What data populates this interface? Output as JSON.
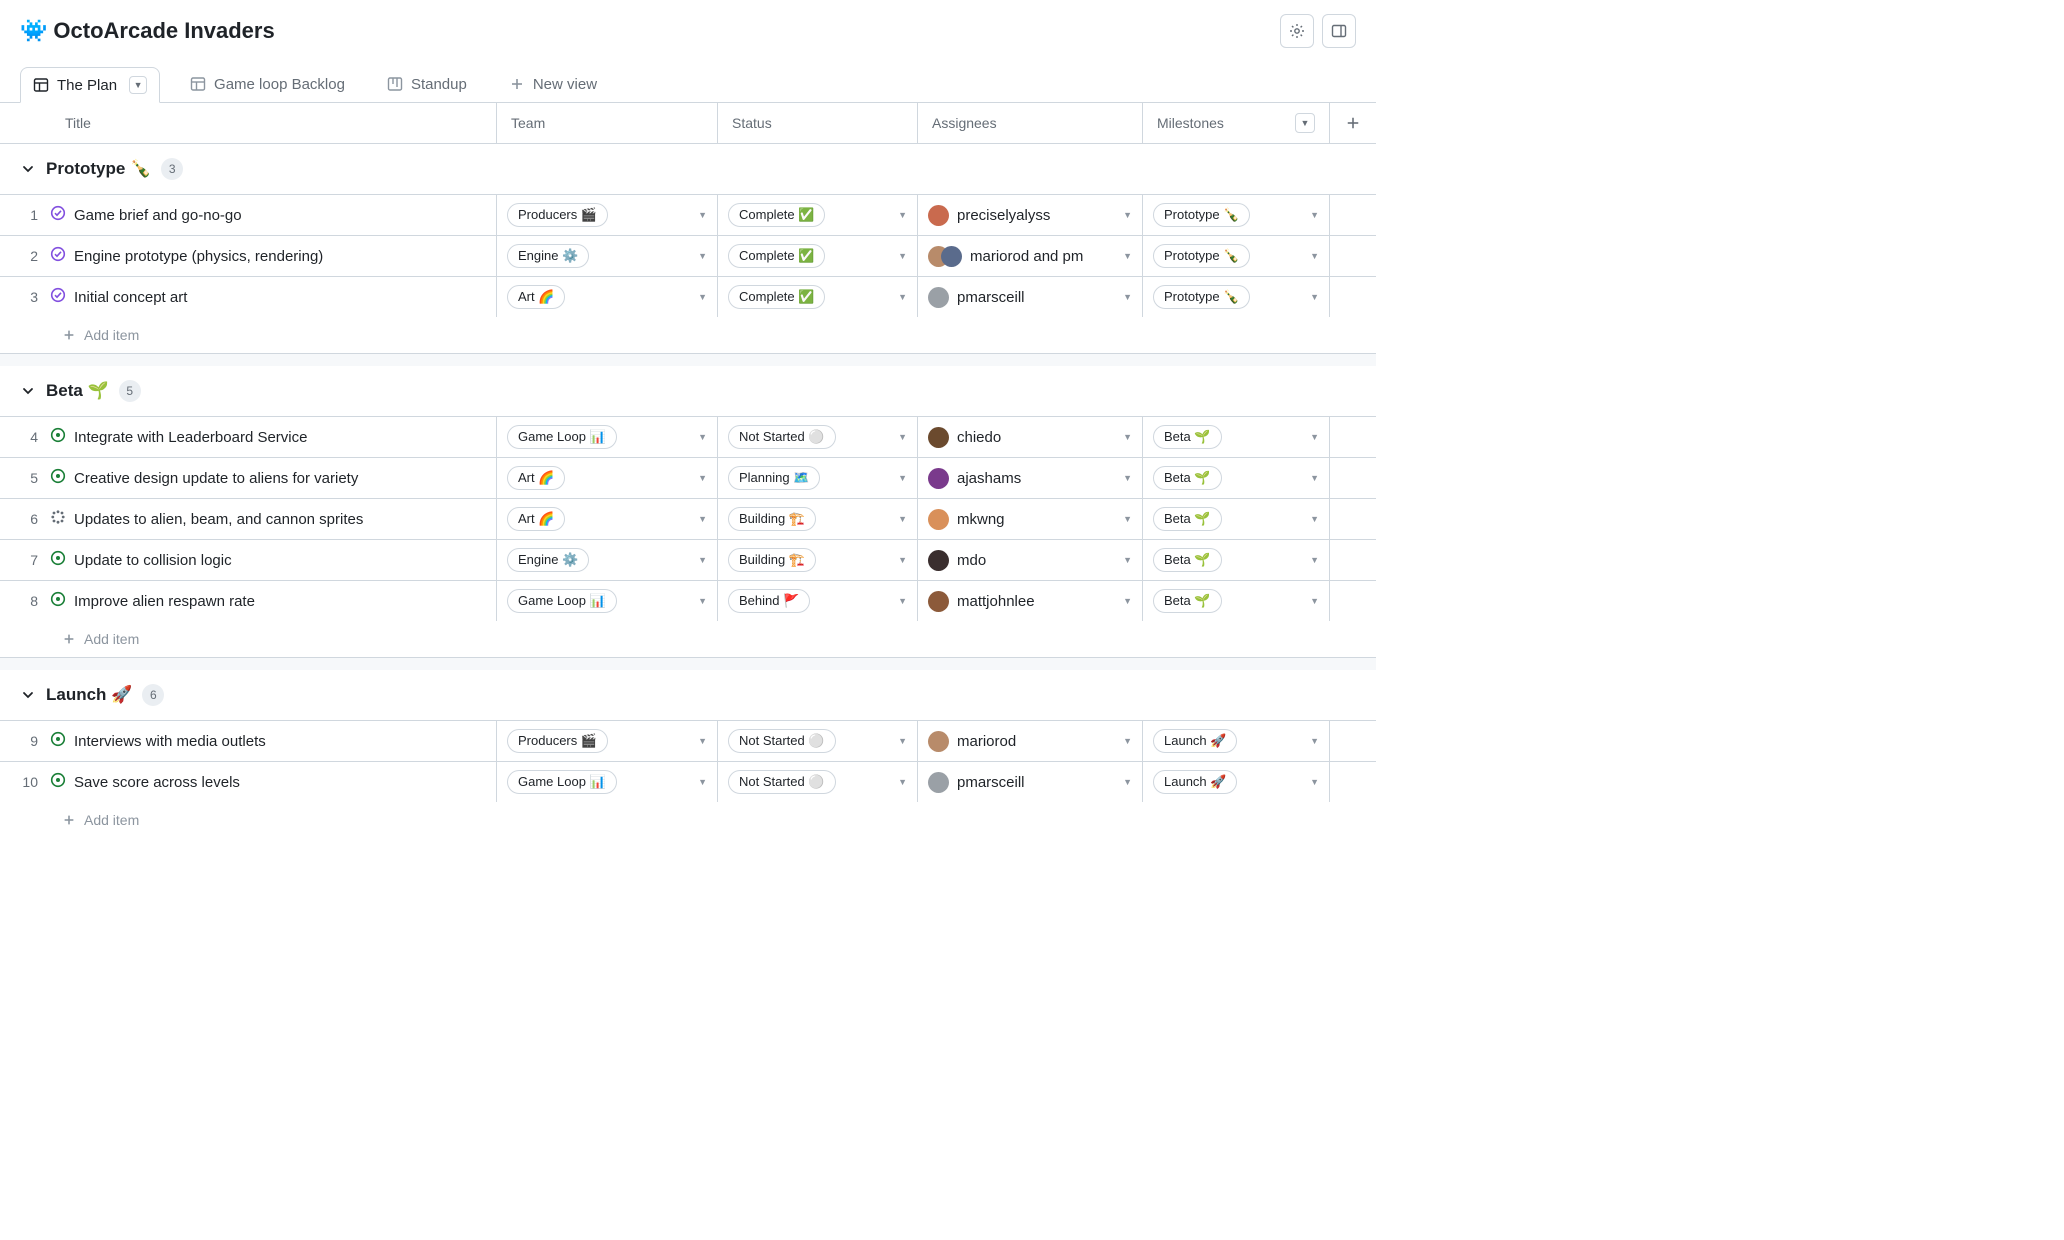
{
  "project": {
    "icon": "👾",
    "title": "OctoArcade Invaders"
  },
  "tabs": [
    {
      "label": "The Plan",
      "icon": "table",
      "active": true,
      "caret": true
    },
    {
      "label": "Game loop Backlog",
      "icon": "table",
      "active": false
    },
    {
      "label": "Standup",
      "icon": "board",
      "active": false
    },
    {
      "label": "New view",
      "icon": "plus",
      "active": false
    }
  ],
  "columns": {
    "title": "Title",
    "team": "Team",
    "status": "Status",
    "assignees": "Assignees",
    "milestones": "Milestones"
  },
  "add_item_label": "Add item",
  "groups": [
    {
      "title": "Prototype",
      "emoji": "🍾",
      "count": "3",
      "rows": [
        {
          "num": "1",
          "icon": "done-purple",
          "title": "Game brief and go-no-go",
          "team": "Producers 🎬",
          "status": "Complete ✅",
          "avatars": [
            "#c96a4e"
          ],
          "assignee": "preciselyalyss",
          "milestone": "Prototype 🍾"
        },
        {
          "num": "2",
          "icon": "done-purple",
          "title": "Engine prototype (physics, rendering)",
          "team": "Engine ⚙️",
          "status": "Complete ✅",
          "avatars": [
            "#b88b6a",
            "#5a6b8c"
          ],
          "assignee": "mariorod and pm",
          "milestone": "Prototype 🍾"
        },
        {
          "num": "3",
          "icon": "done-purple",
          "title": "Initial concept art",
          "team": "Art 🌈",
          "status": "Complete ✅",
          "avatars": [
            "#9aa0a6"
          ],
          "assignee": "pmarsceill",
          "milestone": "Prototype 🍾"
        }
      ]
    },
    {
      "title": "Beta",
      "emoji": "🌱",
      "count": "5",
      "rows": [
        {
          "num": "4",
          "icon": "open-green",
          "title": "Integrate with Leaderboard Service",
          "team": "Game Loop 📊",
          "status": "Not Started ⚪",
          "avatars": [
            "#6b4a2e"
          ],
          "assignee": "chiedo",
          "milestone": "Beta 🌱"
        },
        {
          "num": "5",
          "icon": "open-green",
          "title": "Creative design update to aliens for variety",
          "team": "Art 🌈",
          "status": "Planning 🗺️",
          "avatars": [
            "#7a3a8c"
          ],
          "assignee": "ajashams",
          "milestone": "Beta 🌱"
        },
        {
          "num": "6",
          "icon": "draft-gray",
          "title": "Updates to alien, beam, and cannon sprites",
          "team": "Art 🌈",
          "status": "Building 🏗️",
          "avatars": [
            "#d9905a"
          ],
          "assignee": "mkwng",
          "milestone": "Beta 🌱"
        },
        {
          "num": "7",
          "icon": "open-green",
          "title": "Update to collision logic",
          "team": "Engine ⚙️",
          "status": "Building 🏗️",
          "avatars": [
            "#3a2e2e"
          ],
          "assignee": "mdo",
          "milestone": "Beta 🌱"
        },
        {
          "num": "8",
          "icon": "open-green",
          "title": "Improve alien respawn rate",
          "team": "Game Loop 📊",
          "status": "Behind 🚩",
          "avatars": [
            "#8c5a3a"
          ],
          "assignee": "mattjohnlee",
          "milestone": "Beta 🌱"
        }
      ]
    },
    {
      "title": "Launch",
      "emoji": "🚀",
      "count": "6",
      "rows": [
        {
          "num": "9",
          "icon": "open-green",
          "title": "Interviews with media outlets",
          "team": "Producers 🎬",
          "status": "Not Started ⚪",
          "avatars": [
            "#b88b6a"
          ],
          "assignee": "mariorod",
          "milestone": "Launch 🚀"
        },
        {
          "num": "10",
          "icon": "open-green",
          "title": "Save score across levels",
          "team": "Game Loop 📊",
          "status": "Not Started ⚪",
          "avatars": [
            "#9aa0a6"
          ],
          "assignee": "pmarsceill",
          "milestone": "Launch 🚀"
        }
      ]
    }
  ]
}
